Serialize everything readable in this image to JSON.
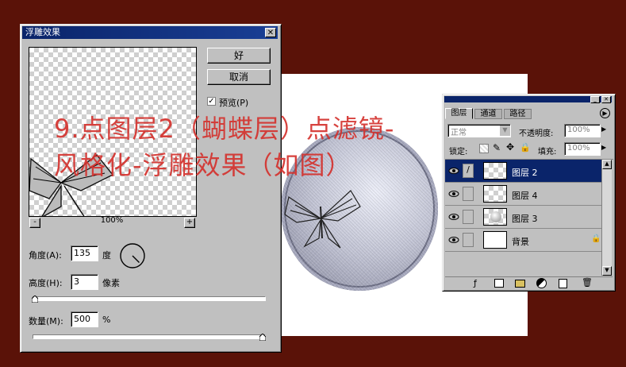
{
  "dialog": {
    "title": "浮雕效果",
    "ok": "好",
    "cancel": "取消",
    "preview_label": "预览(P)",
    "preview_checked": true,
    "zoom_minus": "-",
    "zoom_plus": "+",
    "zoom": "100%",
    "angle_label": "角度(A):",
    "angle_value": "135",
    "angle_unit": "度",
    "angle_degrees": 135,
    "height_label": "高度(H):",
    "height_value": "3",
    "height_unit": "像素",
    "height_slider_fraction": 0.01,
    "amount_label": "数量(M):",
    "amount_value": "500",
    "amount_unit": "%",
    "amount_slider_fraction": 1.0
  },
  "overlay": {
    "line1": "9.点图层2（蝴蝶层）点滤镜-",
    "line2": "风格化-浮雕效果（如图）"
  },
  "layers_panel": {
    "tabs": [
      "图层",
      "通道",
      "路径"
    ],
    "blend_mode": "正常",
    "opacity_label": "不透明度:",
    "opacity_value": "100%",
    "lock_label": "锁定:",
    "fill_label": "填充:",
    "fill_value": "100%",
    "layers": [
      {
        "name": "图层 2",
        "selected": true
      },
      {
        "name": "图层 4",
        "selected": false
      },
      {
        "name": "图层 3",
        "selected": false
      },
      {
        "name": "背景",
        "selected": false
      }
    ]
  },
  "colors": {
    "background": "#5a1208",
    "title_bar": "#0a246a",
    "selected_layer": "#0a246a",
    "overlay_text": "#d4322e"
  }
}
